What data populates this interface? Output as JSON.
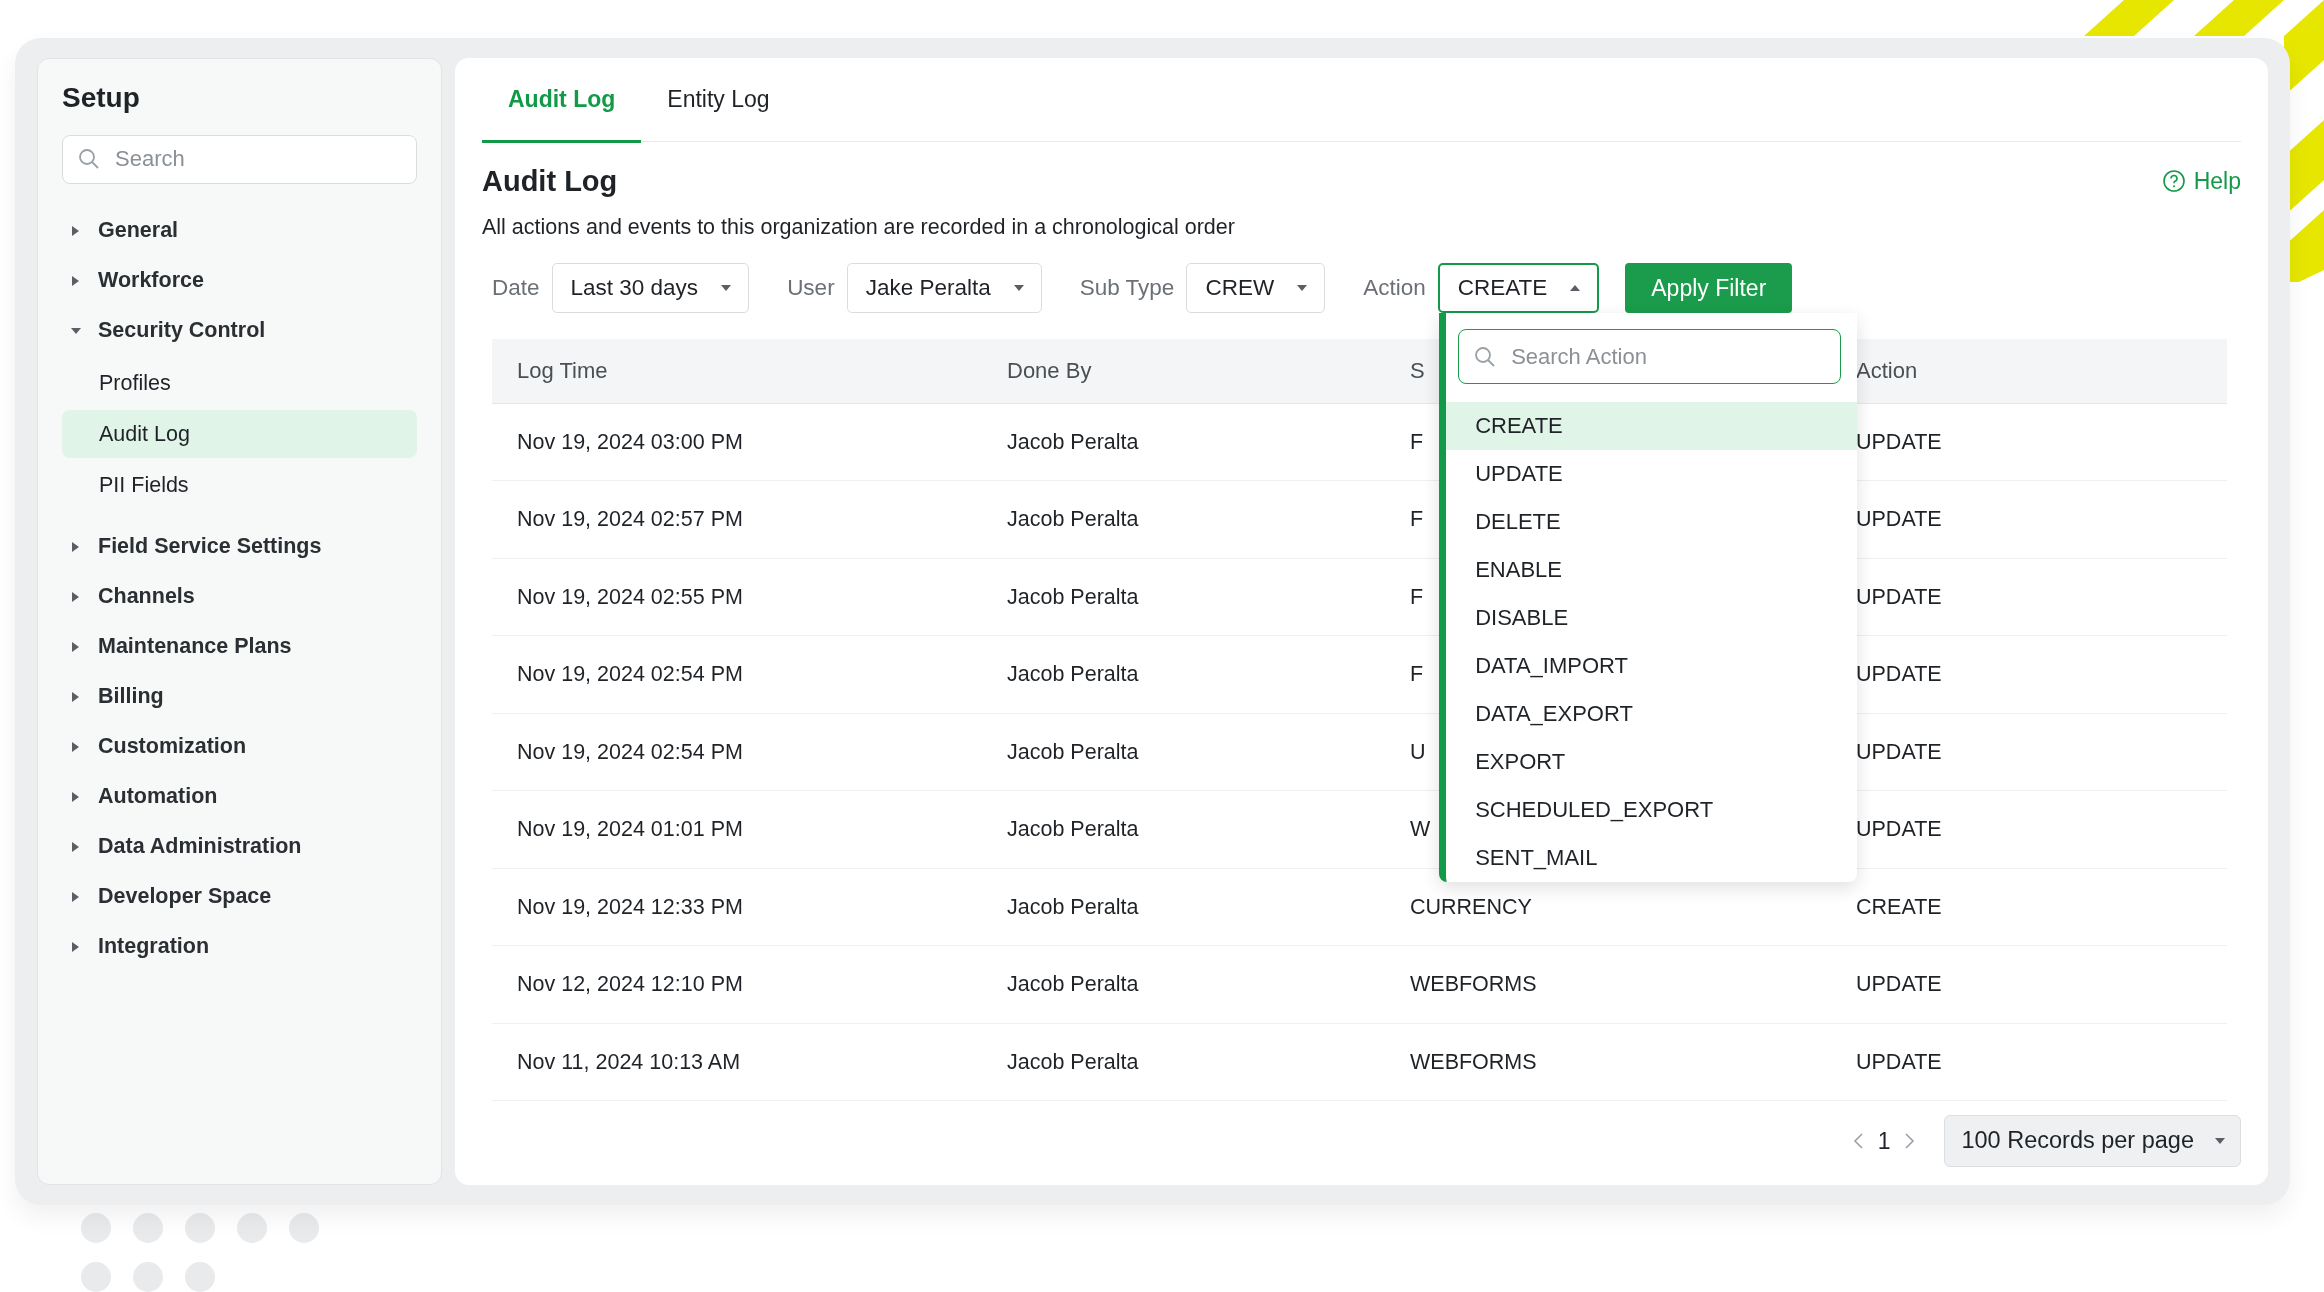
{
  "sidebar": {
    "title": "Setup",
    "search": {
      "placeholder": "Search"
    },
    "items": [
      {
        "label": "General",
        "expanded": false
      },
      {
        "label": "Workforce",
        "expanded": false
      },
      {
        "label": "Security Control",
        "expanded": true,
        "children": [
          {
            "label": "Profiles",
            "selected": false
          },
          {
            "label": "Audit Log",
            "selected": true
          },
          {
            "label": "PII Fields",
            "selected": false
          }
        ]
      },
      {
        "label": "Field Service Settings",
        "expanded": false
      },
      {
        "label": "Channels",
        "expanded": false
      },
      {
        "label": "Maintenance Plans",
        "expanded": false
      },
      {
        "label": "Billing",
        "expanded": false
      },
      {
        "label": "Customization",
        "expanded": false
      },
      {
        "label": "Automation",
        "expanded": false
      },
      {
        "label": "Data Administration",
        "expanded": false
      },
      {
        "label": "Developer Space",
        "expanded": false
      },
      {
        "label": "Integration",
        "expanded": false
      }
    ]
  },
  "tabs": [
    {
      "label": "Audit Log",
      "selected": true
    },
    {
      "label": "Entity Log",
      "selected": false
    }
  ],
  "page": {
    "title": "Audit Log",
    "help": "Help",
    "description": "All actions and events to this organization are recorded in a chronological order"
  },
  "filters": [
    {
      "label": "Date",
      "value": "Last 30 days",
      "open": false
    },
    {
      "label": "User",
      "value": "Jake Peralta",
      "open": false
    },
    {
      "label": "Sub Type",
      "value": "CREW",
      "open": false
    },
    {
      "label": "Action",
      "value": "CREATE",
      "open": true
    }
  ],
  "apply_button": "Apply Filter",
  "action_dropdown": {
    "search": {
      "placeholder": "Search Action"
    },
    "options": [
      {
        "label": "CREATE",
        "selected": true
      },
      {
        "label": "UPDATE",
        "selected": false
      },
      {
        "label": "DELETE",
        "selected": false
      },
      {
        "label": "ENABLE",
        "selected": false
      },
      {
        "label": "DISABLE",
        "selected": false
      },
      {
        "label": "DATA_IMPORT",
        "selected": false
      },
      {
        "label": "DATA_EXPORT",
        "selected": false
      },
      {
        "label": "EXPORT",
        "selected": false
      },
      {
        "label": "SCHEDULED_EXPORT",
        "selected": false
      },
      {
        "label": "SENT_MAIL",
        "selected": false
      }
    ]
  },
  "table": {
    "columns": [
      "Log Time",
      "Done By",
      "S",
      "Action"
    ],
    "rows": [
      [
        "Nov 19, 2024 03:00 PM",
        "Jacob Peralta",
        "F",
        "UPDATE"
      ],
      [
        "Nov 19, 2024 02:57 PM",
        "Jacob Peralta",
        "F",
        "UPDATE"
      ],
      [
        "Nov 19, 2024 02:55 PM",
        "Jacob Peralta",
        "F",
        "UPDATE"
      ],
      [
        "Nov 19, 2024 02:54 PM",
        "Jacob Peralta",
        "F",
        "UPDATE"
      ],
      [
        "Nov 19, 2024 02:54 PM",
        "Jacob Peralta",
        "U",
        "UPDATE"
      ],
      [
        "Nov 19, 2024 01:01 PM",
        "Jacob Peralta",
        "W",
        "UPDATE"
      ],
      [
        "Nov 19, 2024 12:33 PM",
        "Jacob Peralta",
        "CURRENCY",
        "CREATE"
      ],
      [
        "Nov 12, 2024 12:10 PM",
        "Jacob Peralta",
        "WEBFORMS",
        "UPDATE"
      ],
      [
        "Nov 11, 2024 10:13 AM",
        "Jacob Peralta",
        "WEBFORMS",
        "UPDATE"
      ]
    ]
  },
  "pagination": {
    "page": "1",
    "per_page": "100 Records per page"
  }
}
